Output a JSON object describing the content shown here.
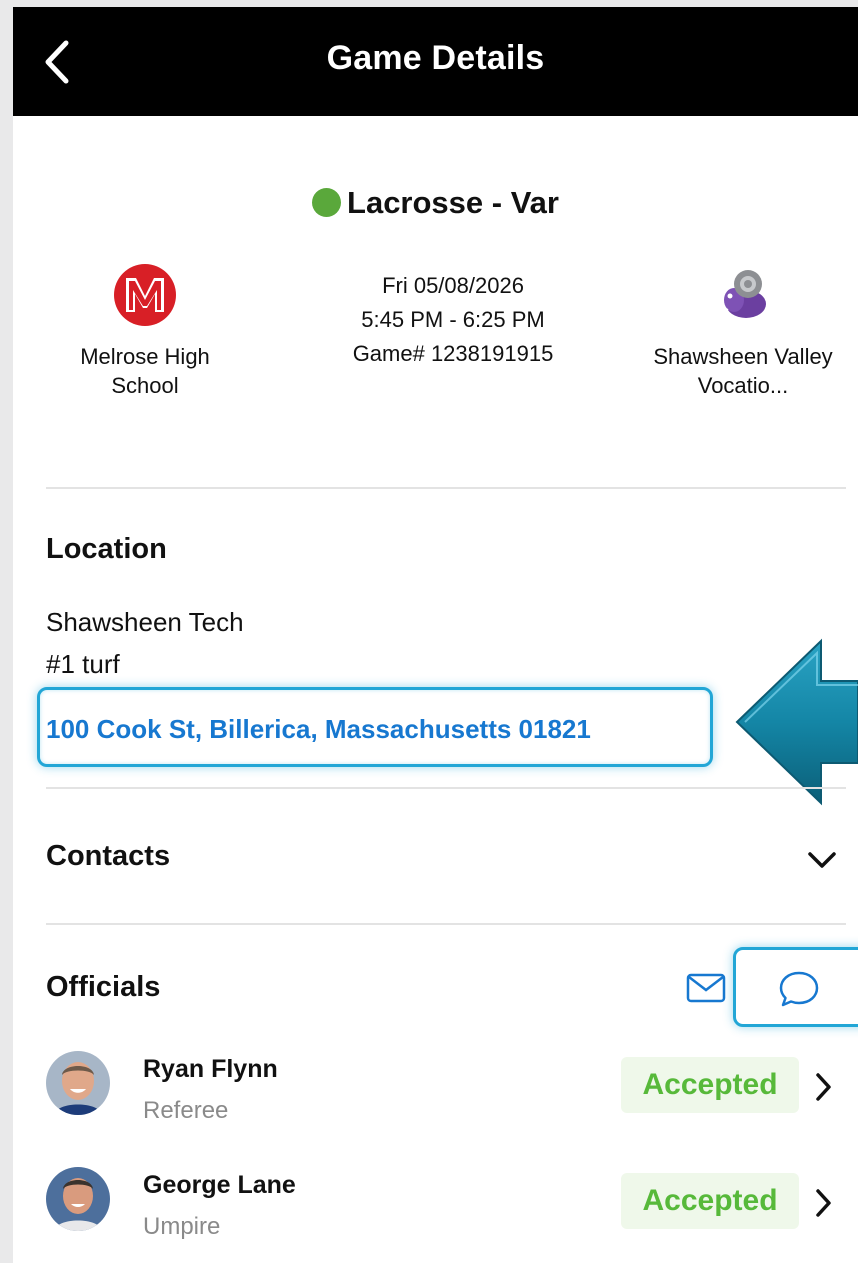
{
  "header": {
    "title": "Game Details",
    "back_icon": "chevron-left-icon"
  },
  "game": {
    "sport": "Lacrosse - Var",
    "status_color": "#5aa83b",
    "date": "Fri 05/08/2026",
    "time": "5:45 PM - 6:25 PM",
    "game_number": "Game# 1238191915"
  },
  "home_team": {
    "name": "Melrose High School",
    "logo_letter": "M",
    "logo_color": "#d81f26"
  },
  "away_team": {
    "name": "Shawsheen Valley Vocatio...",
    "logo": "ram-mascot"
  },
  "location": {
    "heading": "Location",
    "venue": "Shawsheen Tech",
    "field": "#1 turf",
    "address": "100 Cook St, Billerica, Massachusetts 01821"
  },
  "contacts": {
    "heading": "Contacts",
    "toggle_icon": "chevron-down-icon"
  },
  "officials": {
    "heading": "Officials",
    "mail_icon": "mail-icon",
    "chat_icon": "chat-bubble-icon",
    "items": [
      {
        "name": "Ryan Flynn",
        "role": "Referee",
        "status": "Accepted"
      },
      {
        "name": "George Lane",
        "role": "Umpire",
        "status": "Accepted"
      }
    ]
  },
  "colors": {
    "accent": "#1778d0",
    "highlight": "#22a6d6",
    "accepted": "#57b93a"
  }
}
